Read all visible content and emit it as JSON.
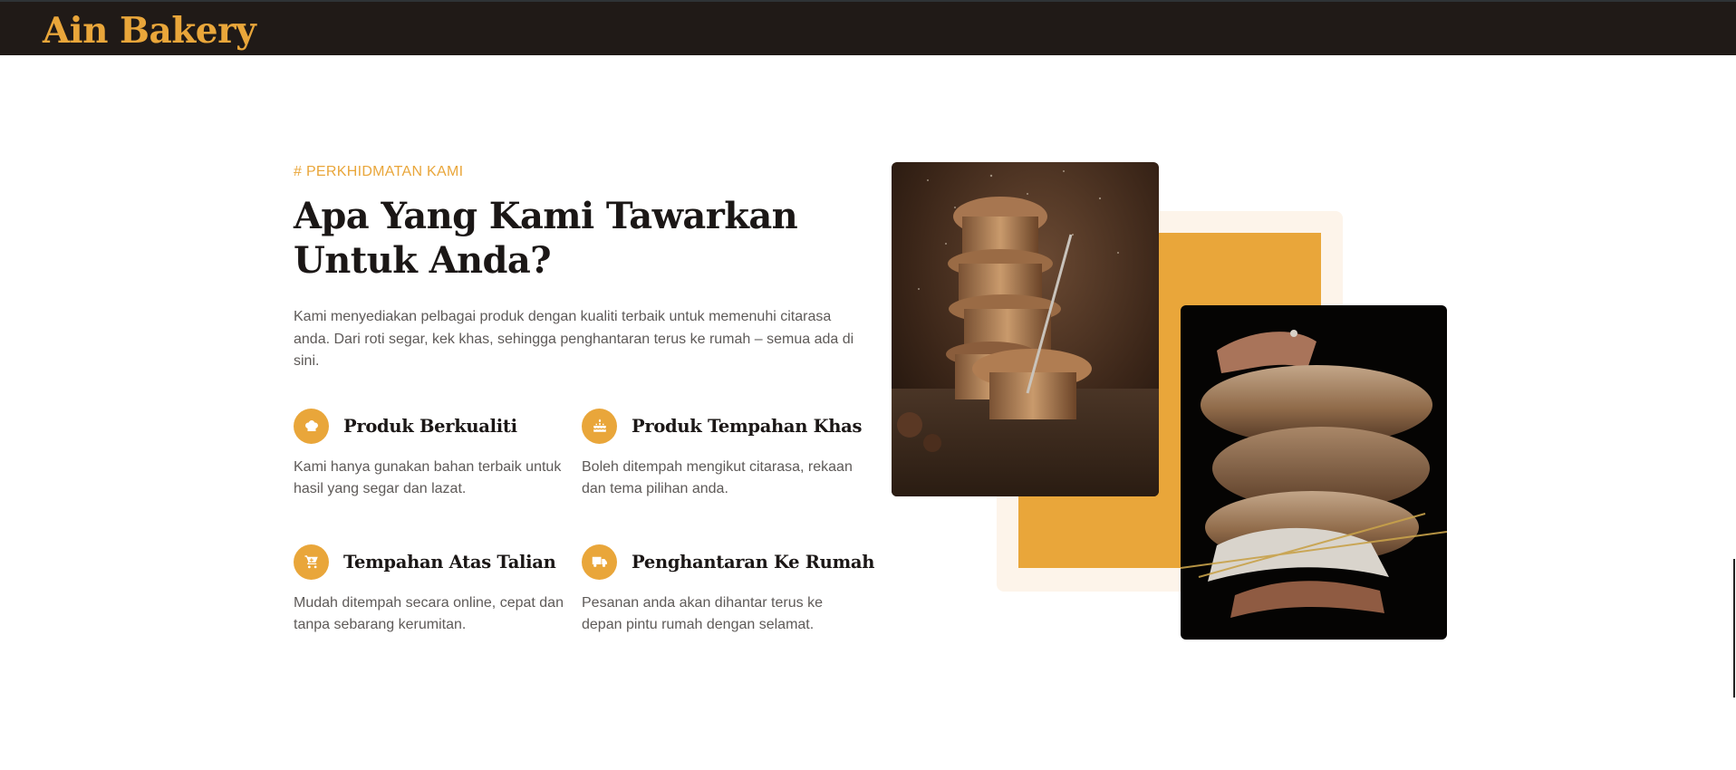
{
  "header": {
    "brand": "Ain Bakery"
  },
  "services": {
    "eyebrow": "# PERKHIDMATAN KAMI",
    "title": "Apa Yang Kami Tawarkan Untuk Anda?",
    "description": "Kami menyediakan pelbagai produk dengan kualiti terbaik untuk memenuhi citarasa anda. Dari roti segar, kek khas, sehingga penghantaran terus ke rumah – semua ada di sini.",
    "features": [
      {
        "icon": "chef-hat-icon",
        "title": "Produk Berkualiti",
        "description": "Kami hanya gunakan bahan terbaik untuk hasil yang segar dan lazat."
      },
      {
        "icon": "birthday-cake-icon",
        "title": "Produk Tempahan Khas",
        "description": "Boleh ditempah mengikut citarasa, rekaan dan tema pilihan anda."
      },
      {
        "icon": "shopping-cart-icon",
        "title": "Tempahan Atas Talian",
        "description": "Mudah ditempah secara online, cepat dan tanpa sebarang kerumitan."
      },
      {
        "icon": "delivery-truck-icon",
        "title": "Penghantaran Ke Rumah",
        "description": "Pesanan anda akan dihantar terus ke depan pintu rumah dengan selamat."
      }
    ]
  },
  "images": [
    {
      "name": "cupcakes-photo",
      "subject": "stacked muffins dusted with sugar"
    },
    {
      "name": "bread-photo",
      "subject": "hands holding stacked bread loaves"
    }
  ],
  "colors": {
    "accent": "#e9a63a",
    "header_bg": "#201a17",
    "cream": "#fdf4ea",
    "heading": "#1b1716",
    "body_text": "#5e5a58"
  }
}
